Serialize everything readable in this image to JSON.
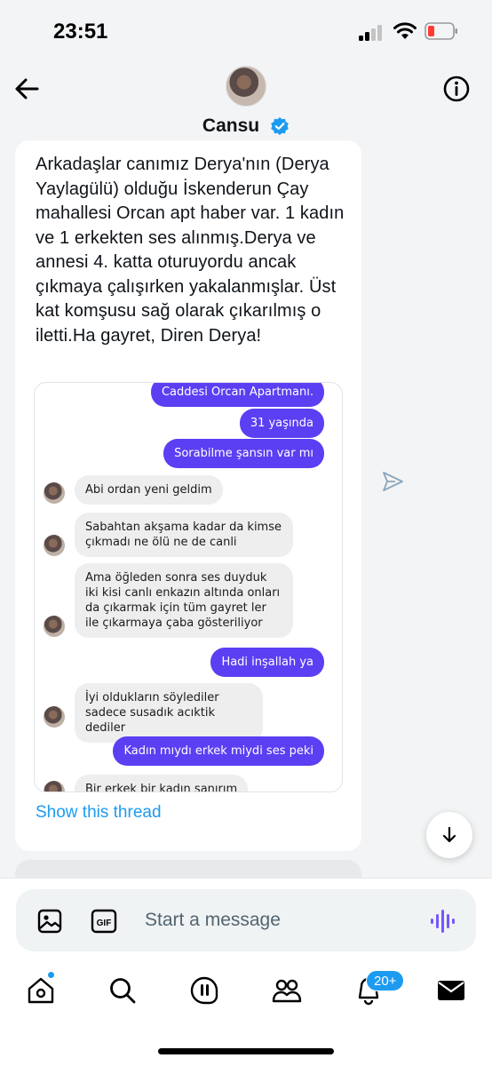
{
  "status_bar": {
    "time": "23:51"
  },
  "header": {
    "name": "Cansu",
    "apple_glyph": ""
  },
  "tweet": {
    "text": "Arkadaşlar canımız Derya'nın (Derya Yaylagülü) olduğu İskenderun Çay mahallesi Orcan apt haber var. 1 kadın ve 1 erkekten ses alınmış.Derya ve annesi 4. katta oturuyordu ancak çıkmaya çalışırken yakalanmışlar. Üst kat komşusu sağ olarak çıkarılmış o iletti.Ha gayret, Diren Derya!",
    "show_thread": "Show this thread"
  },
  "chat": [
    {
      "dir": "out",
      "text": "Caddesi Orcan Apartmanı."
    },
    {
      "dir": "out",
      "text": "31 yaşında"
    },
    {
      "dir": "out",
      "text": "Sorabilme şansın var mı"
    },
    {
      "dir": "in",
      "text": "Abi ordan yeni geldim"
    },
    {
      "dir": "in",
      "text": "Sabahtan akşama kadar da kimse çıkmadı ne ölü ne de canli"
    },
    {
      "dir": "in",
      "text": "Ama öğleden sonra ses duyduk iki kisi canlı enkazın altında onları da çıkarmak için tüm gayret ler ile çıkarmaya çaba gösteriliyor"
    },
    {
      "dir": "out",
      "text": "Hadi inşallah ya"
    },
    {
      "dir": "in",
      "text": "İyi oldukların söylediler sadece susadık acıktik dediler"
    },
    {
      "dir": "out",
      "text": "Kadın mıydı erkek miydi ses peki"
    },
    {
      "dir": "in",
      "text": "Bir erkek bir kadın sanırım"
    }
  ],
  "composer": {
    "placeholder": "Start a message"
  },
  "tabbar": {
    "notifications_badge": "20+"
  },
  "colors": {
    "accent": "#1d9bf0",
    "chat_out": "#5b3ff2",
    "chat_in": "#eeeeef"
  }
}
